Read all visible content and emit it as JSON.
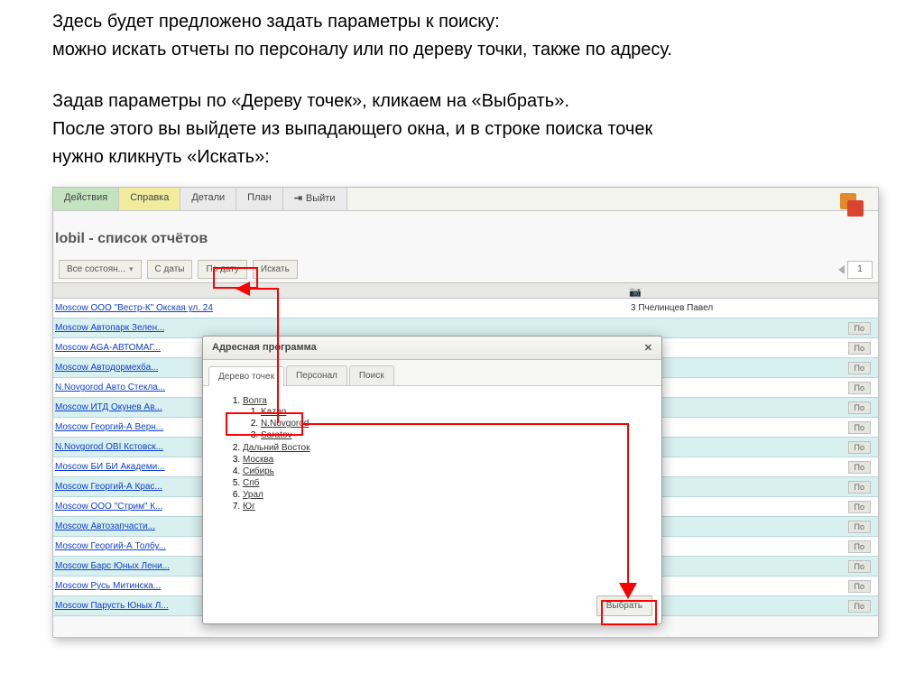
{
  "intro": {
    "line1": "Здесь будет предложено задать параметры к поиску:",
    "line2": "можно искать отчеты по персоналу или по дереву точки, также по адресу.",
    "line3": "Задав параметры по «Дереву точек», кликаем на «Выбрать».",
    "line4": "После этого вы выйдете из выпадающего окна, и в строке поиска точек",
    "line5": "нужно кликнуть «Искать»:"
  },
  "menu": {
    "actions": "Действия",
    "reference": "Справка",
    "details": "Детали",
    "plan": "План",
    "exit": "Выйти"
  },
  "page": {
    "title": "lobil - список отчётов"
  },
  "filters": {
    "state": "Все состоян...",
    "from_date": "С даты",
    "to_date": "По дату",
    "search": "Искать",
    "page": "1"
  },
  "modal": {
    "title": "Адресная программа",
    "close": "✕",
    "tab_tree": "Дерево точек",
    "tab_personnel": "Персонал",
    "tab_search": "Поиск",
    "select_btn": "Выбрать"
  },
  "tree": {
    "n1": "Волга",
    "n1_1": "Kazan",
    "n1_2": "N.Novgorod",
    "n1_3": "Saratov",
    "n2": "Дальний Восток",
    "n3": "Москва",
    "n4": "Сибирь",
    "n5": "Спб",
    "n6": "Урал",
    "n7": "Юг"
  },
  "count_cell": "3 Пчелинцев Павел",
  "po_label": "По",
  "rows": [
    {
      "link": "Moscow ООО \"Вестр-К\" Окская ул. 24"
    },
    {
      "link": "Moscow Автопарк Зелен..."
    },
    {
      "link": "Moscow AGA-АВТОМАГ..."
    },
    {
      "link": "Moscow Автодормехба..."
    },
    {
      "link": "N.Novgorod Авто Стекла..."
    },
    {
      "link": "Moscow ИТД Окунев Ав..."
    },
    {
      "link": "Moscow Георгий-А Верн..."
    },
    {
      "link": "N.Novgorod OBI Кстовск..."
    },
    {
      "link": "Moscow БИ БИ Академи..."
    },
    {
      "link": "Moscow Георгий-А Крас..."
    },
    {
      "link": "Moscow ООО \"Стрим\" К..."
    },
    {
      "link": "Moscow Автозапчасти..."
    },
    {
      "link": "Moscow Георгий-А Толбу..."
    },
    {
      "link": "Moscow Барс Юных Лени..."
    },
    {
      "link": "Moscow Русь Митинска..."
    },
    {
      "link": "Moscow Парусть Юных Л..."
    }
  ]
}
